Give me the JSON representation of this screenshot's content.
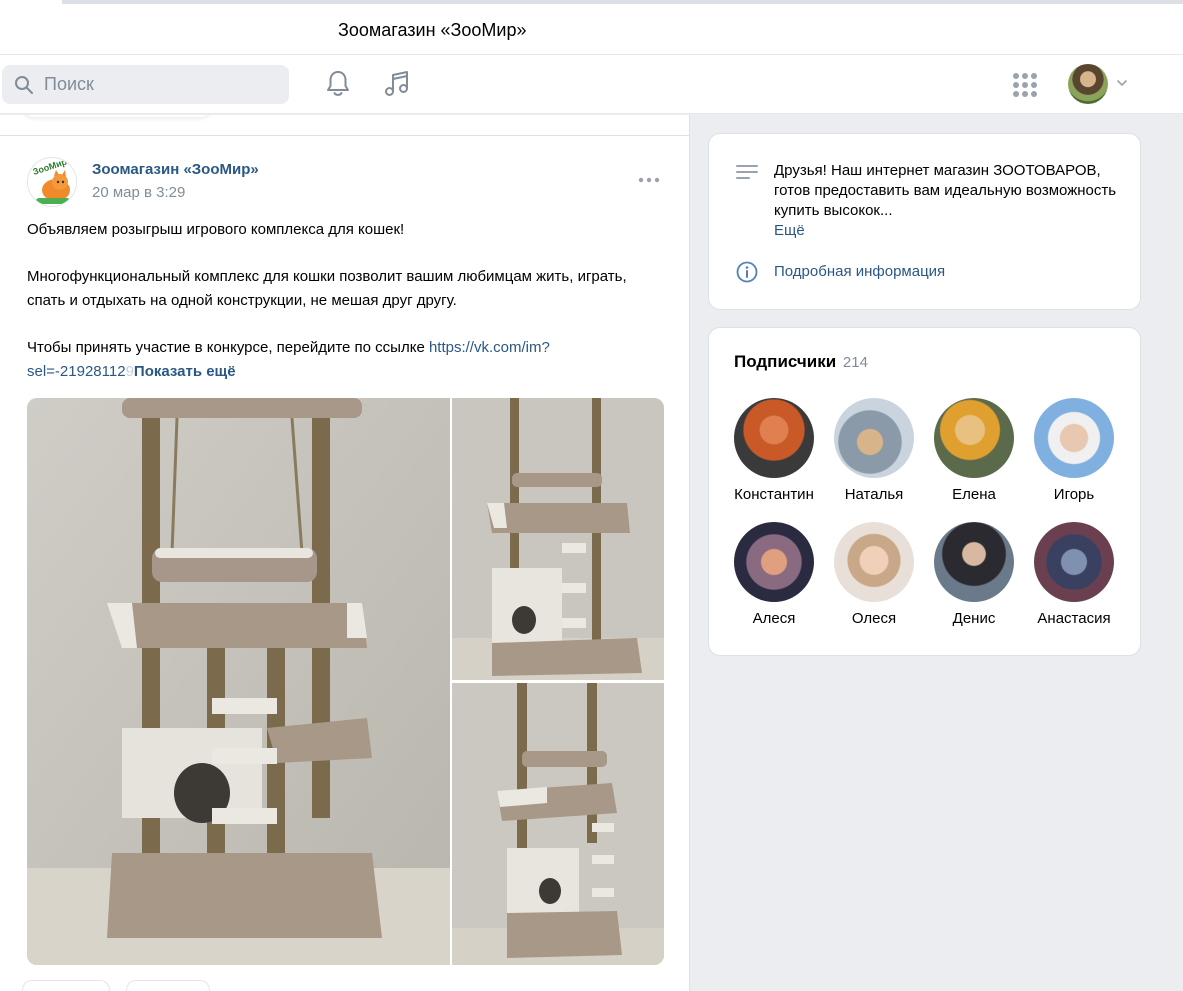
{
  "window": {
    "title": "Зоомагазин «ЗооМир»"
  },
  "header": {
    "search_placeholder": "Поиск",
    "icons": [
      "search-icon",
      "bell-icon",
      "music-icon",
      "apps-icon",
      "chevron-down-icon"
    ]
  },
  "post": {
    "author": "Зоомагазин «ЗооМир»",
    "date": "20 мар в 3:29",
    "avatar_text": "ЗооМир",
    "text_line1": "Объявляем розыгрыш игрового комплекса для кошек!",
    "text_line2": "Многофункциональный комплекс для кошки позволит вашим любимцам жить, играть, спать и отдыхать на одной конструкции, не мешая друг другу.",
    "text_line3": "Чтобы принять участие в конкурсе, перейдите по ссылке ",
    "link": "https://vk.com/im?sel=-21928112",
    "link_fade": "9",
    "show_more": "Показать ещё"
  },
  "info": {
    "description": "Друзья! Наш интернет магазин ЗООТОВАРОВ, готов предоставить вам идеальную возможность купить высокок...",
    "more": "Ещё",
    "details_link": "Подробная информация"
  },
  "subscribers": {
    "title": "Подписчики",
    "count": "214",
    "items": [
      {
        "name": "Константин",
        "color": "#b85a2a"
      },
      {
        "name": "Наталья",
        "color": "#9bb0c4"
      },
      {
        "name": "Елена",
        "color": "#c9a060"
      },
      {
        "name": "Игорь",
        "color": "#8fb6dc"
      },
      {
        "name": "Алеся",
        "color": "#6b5a70"
      },
      {
        "name": "Олеся",
        "color": "#c8b5a3"
      },
      {
        "name": "Денис",
        "color": "#5a6a7a"
      },
      {
        "name": "Анастасия",
        "color": "#4a5670"
      }
    ]
  }
}
